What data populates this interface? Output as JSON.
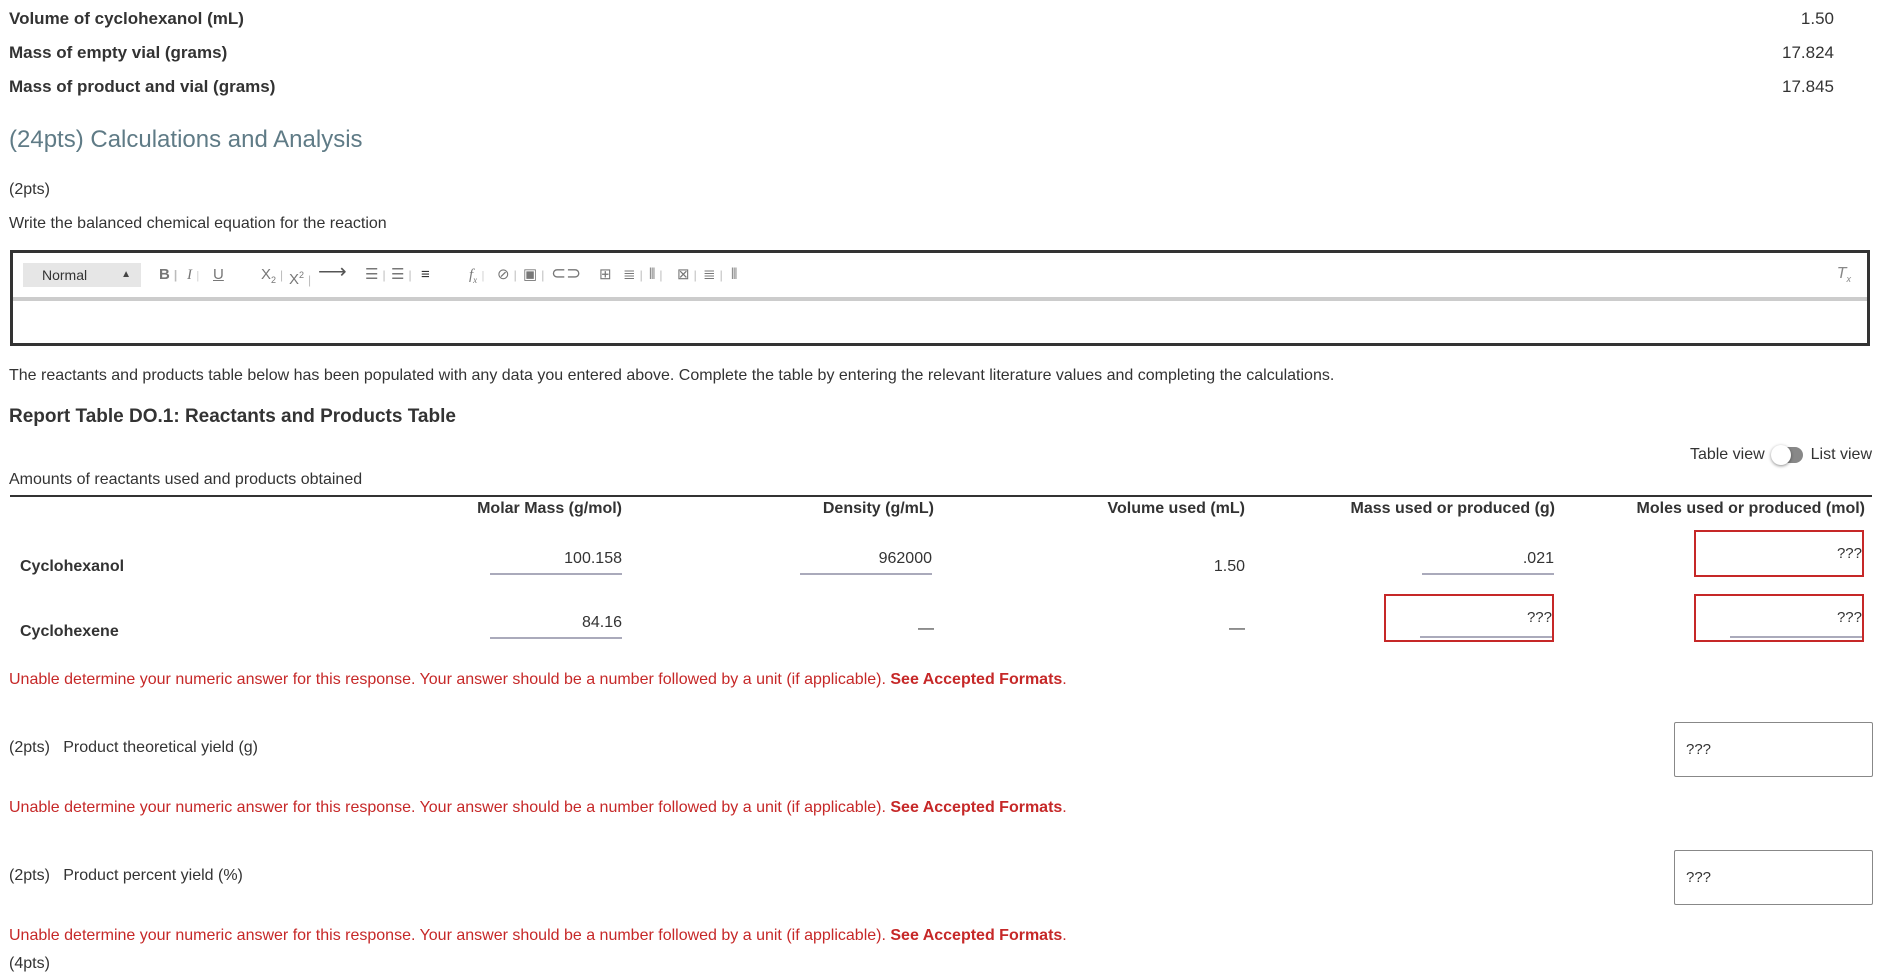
{
  "measurements": [
    {
      "label": "Volume of cyclohexanol (mL)",
      "value": "1.50"
    },
    {
      "label": "Mass of empty vial (grams)",
      "value": "17.824"
    },
    {
      "label": "Mass of product and vial (grams)",
      "value": "17.845"
    }
  ],
  "section_title": "(24pts) Calculations and Analysis",
  "equation_question": {
    "points": "(2pts)",
    "prompt": "Write the balanced chemical equation for the reaction"
  },
  "editor": {
    "format_select": "Normal",
    "toolbar_icons": [
      "bold-icon",
      "italic-icon",
      "underline-icon",
      "subscript-icon",
      "superscript-icon",
      "arrow-icon",
      "ordered-list-icon",
      "bullet-list-icon",
      "align-icon",
      "formula-icon",
      "link-icon",
      "image-icon",
      "attachment-icon",
      "table-icon",
      "table-row-icon",
      "table-column-icon",
      "table-delete-icon",
      "table-row-delete-icon",
      "table-column-delete-icon",
      "clear-format-icon"
    ]
  },
  "intro_text": "The reactants and products table below has been populated with any data you entered above. Complete the table by entering the relevant literature values and completing the calculations.",
  "table": {
    "title": "Report Table DO.1: Reactants and Products Table",
    "view_toggle": {
      "left": "Table view",
      "right": "List view"
    },
    "caption": "Amounts of reactants used and products obtained",
    "columns": [
      "Molar Mass (g/mol)",
      "Density (g/mL)",
      "Volume used (mL)",
      "Mass used or produced (g)",
      "Moles used or produced (mol)"
    ],
    "rows": [
      {
        "label": "Cyclohexanol",
        "molar_mass": "100.158",
        "density": "962000",
        "volume": "1.50",
        "mass": ".021",
        "moles": "???"
      },
      {
        "label": "Cyclohexene",
        "molar_mass": "84.16",
        "density": "—",
        "volume": "—",
        "mass": "???",
        "moles": "???"
      }
    ]
  },
  "error": {
    "message": "Unable determine your numeric answer for this response. Your answer should be a number followed by a unit (if applicable).",
    "link": "See Accepted Formats"
  },
  "theoretical_yield": {
    "points": "(2pts)",
    "label": "Product theoretical yield (g)",
    "value": "???"
  },
  "percent_yield": {
    "points": "(2pts)",
    "label": "Product percent yield (%)",
    "value": "???"
  },
  "next_points": "(4pts)",
  "colors": {
    "error": "#c62828",
    "section_title": "#5f7b86",
    "text": "#333333"
  }
}
